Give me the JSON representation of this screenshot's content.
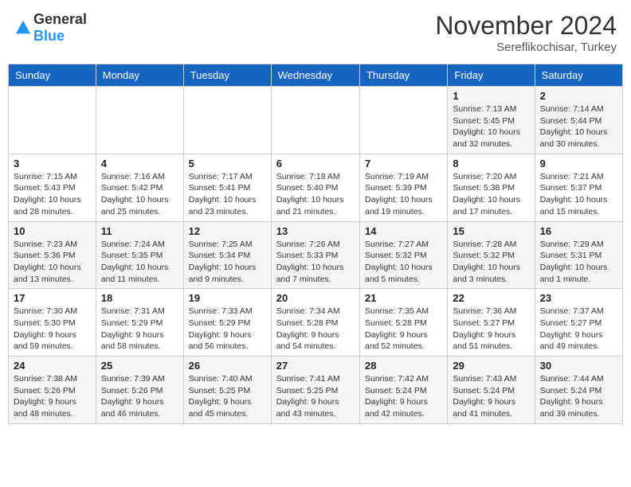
{
  "logo": {
    "text_general": "General",
    "text_blue": "Blue"
  },
  "title": {
    "month": "November 2024",
    "location": "Sereflikochisar, Turkey"
  },
  "days_of_week": [
    "Sunday",
    "Monday",
    "Tuesday",
    "Wednesday",
    "Thursday",
    "Friday",
    "Saturday"
  ],
  "weeks": [
    [
      {
        "day": "",
        "info": ""
      },
      {
        "day": "",
        "info": ""
      },
      {
        "day": "",
        "info": ""
      },
      {
        "day": "",
        "info": ""
      },
      {
        "day": "",
        "info": ""
      },
      {
        "day": "1",
        "info": "Sunrise: 7:13 AM\nSunset: 5:45 PM\nDaylight: 10 hours and 32 minutes."
      },
      {
        "day": "2",
        "info": "Sunrise: 7:14 AM\nSunset: 5:44 PM\nDaylight: 10 hours and 30 minutes."
      }
    ],
    [
      {
        "day": "3",
        "info": "Sunrise: 7:15 AM\nSunset: 5:43 PM\nDaylight: 10 hours and 28 minutes."
      },
      {
        "day": "4",
        "info": "Sunrise: 7:16 AM\nSunset: 5:42 PM\nDaylight: 10 hours and 25 minutes."
      },
      {
        "day": "5",
        "info": "Sunrise: 7:17 AM\nSunset: 5:41 PM\nDaylight: 10 hours and 23 minutes."
      },
      {
        "day": "6",
        "info": "Sunrise: 7:18 AM\nSunset: 5:40 PM\nDaylight: 10 hours and 21 minutes."
      },
      {
        "day": "7",
        "info": "Sunrise: 7:19 AM\nSunset: 5:39 PM\nDaylight: 10 hours and 19 minutes."
      },
      {
        "day": "8",
        "info": "Sunrise: 7:20 AM\nSunset: 5:38 PM\nDaylight: 10 hours and 17 minutes."
      },
      {
        "day": "9",
        "info": "Sunrise: 7:21 AM\nSunset: 5:37 PM\nDaylight: 10 hours and 15 minutes."
      }
    ],
    [
      {
        "day": "10",
        "info": "Sunrise: 7:23 AM\nSunset: 5:36 PM\nDaylight: 10 hours and 13 minutes."
      },
      {
        "day": "11",
        "info": "Sunrise: 7:24 AM\nSunset: 5:35 PM\nDaylight: 10 hours and 11 minutes."
      },
      {
        "day": "12",
        "info": "Sunrise: 7:25 AM\nSunset: 5:34 PM\nDaylight: 10 hours and 9 minutes."
      },
      {
        "day": "13",
        "info": "Sunrise: 7:26 AM\nSunset: 5:33 PM\nDaylight: 10 hours and 7 minutes."
      },
      {
        "day": "14",
        "info": "Sunrise: 7:27 AM\nSunset: 5:32 PM\nDaylight: 10 hours and 5 minutes."
      },
      {
        "day": "15",
        "info": "Sunrise: 7:28 AM\nSunset: 5:32 PM\nDaylight: 10 hours and 3 minutes."
      },
      {
        "day": "16",
        "info": "Sunrise: 7:29 AM\nSunset: 5:31 PM\nDaylight: 10 hours and 1 minute."
      }
    ],
    [
      {
        "day": "17",
        "info": "Sunrise: 7:30 AM\nSunset: 5:30 PM\nDaylight: 9 hours and 59 minutes."
      },
      {
        "day": "18",
        "info": "Sunrise: 7:31 AM\nSunset: 5:29 PM\nDaylight: 9 hours and 58 minutes."
      },
      {
        "day": "19",
        "info": "Sunrise: 7:33 AM\nSunset: 5:29 PM\nDaylight: 9 hours and 56 minutes."
      },
      {
        "day": "20",
        "info": "Sunrise: 7:34 AM\nSunset: 5:28 PM\nDaylight: 9 hours and 54 minutes."
      },
      {
        "day": "21",
        "info": "Sunrise: 7:35 AM\nSunset: 5:28 PM\nDaylight: 9 hours and 52 minutes."
      },
      {
        "day": "22",
        "info": "Sunrise: 7:36 AM\nSunset: 5:27 PM\nDaylight: 9 hours and 51 minutes."
      },
      {
        "day": "23",
        "info": "Sunrise: 7:37 AM\nSunset: 5:27 PM\nDaylight: 9 hours and 49 minutes."
      }
    ],
    [
      {
        "day": "24",
        "info": "Sunrise: 7:38 AM\nSunset: 5:26 PM\nDaylight: 9 hours and 48 minutes."
      },
      {
        "day": "25",
        "info": "Sunrise: 7:39 AM\nSunset: 5:26 PM\nDaylight: 9 hours and 46 minutes."
      },
      {
        "day": "26",
        "info": "Sunrise: 7:40 AM\nSunset: 5:25 PM\nDaylight: 9 hours and 45 minutes."
      },
      {
        "day": "27",
        "info": "Sunrise: 7:41 AM\nSunset: 5:25 PM\nDaylight: 9 hours and 43 minutes."
      },
      {
        "day": "28",
        "info": "Sunrise: 7:42 AM\nSunset: 5:24 PM\nDaylight: 9 hours and 42 minutes."
      },
      {
        "day": "29",
        "info": "Sunrise: 7:43 AM\nSunset: 5:24 PM\nDaylight: 9 hours and 41 minutes."
      },
      {
        "day": "30",
        "info": "Sunrise: 7:44 AM\nSunset: 5:24 PM\nDaylight: 9 hours and 39 minutes."
      }
    ]
  ]
}
